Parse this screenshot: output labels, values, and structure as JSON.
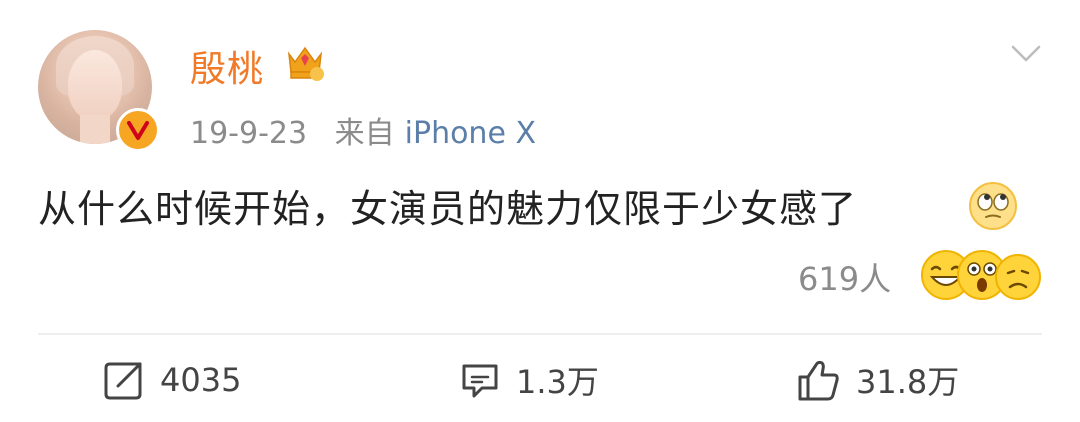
{
  "post": {
    "author": {
      "name": "殷桃",
      "verified_icon": "verified-v-badge",
      "badge_icon": "crown-level-icon"
    },
    "meta": {
      "date": "19-9-23",
      "source_prefix": "来自",
      "source_device": "iPhone X"
    },
    "content": {
      "text": "从什么时候开始，女演员的魅力仅限于少女感了",
      "emoji": "eye-roll-emoji"
    },
    "reactions": {
      "count": "619人",
      "emojis": [
        "laughing-emoji",
        "shocked-emoji",
        "sad-emoji"
      ]
    },
    "actions": {
      "repost": "4035",
      "comment": "1.3万",
      "like": "31.8万"
    }
  },
  "colors": {
    "username": "#f07a28",
    "source_link": "#5b7fa8",
    "meta_gray": "#8b8b8b"
  }
}
